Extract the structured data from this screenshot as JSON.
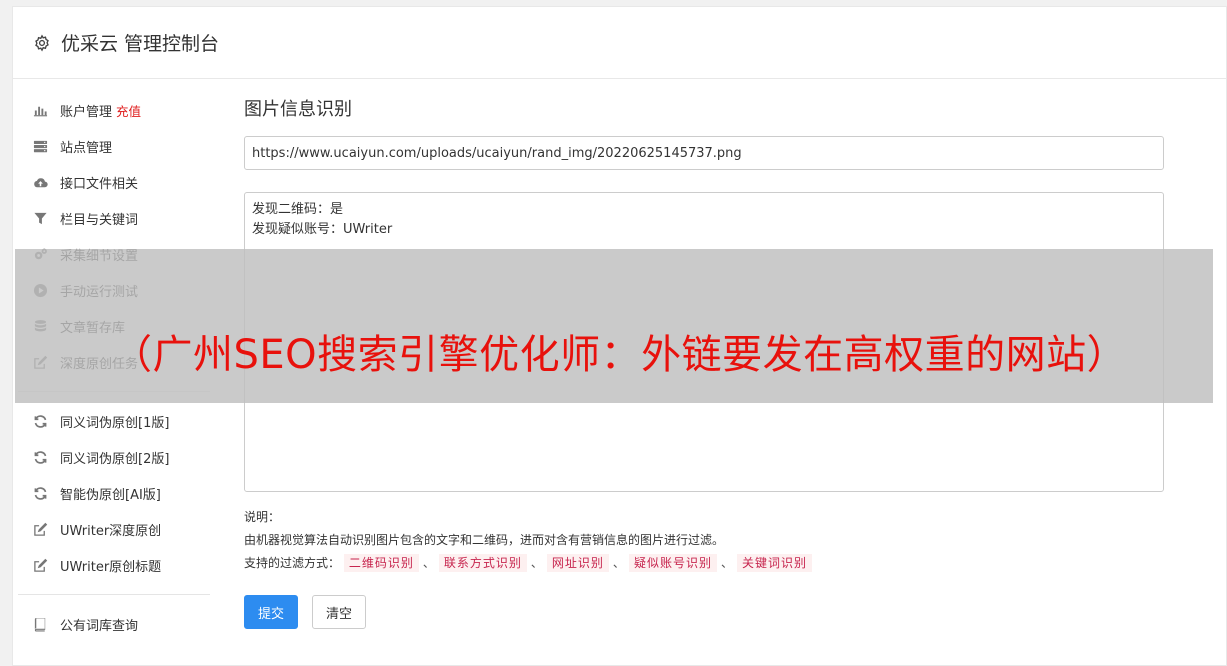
{
  "header": {
    "title": "优采云 管理控制台"
  },
  "sidebar": {
    "groups": [
      [
        {
          "label": "账户管理",
          "badge": "充值",
          "icon": "bar-chart-icon"
        },
        {
          "label": "站点管理",
          "icon": "server-icon"
        },
        {
          "label": "接口文件相关",
          "icon": "cloud-upload-icon"
        },
        {
          "label": "栏目与关键词",
          "icon": "filter-icon"
        },
        {
          "label": "采集细节设置",
          "icon": "gears-icon"
        },
        {
          "label": "手动运行测试",
          "icon": "play-circle-icon"
        },
        {
          "label": "文章暂存库",
          "icon": "database-icon"
        },
        {
          "label": "深度原创任务",
          "icon": "edit-icon"
        }
      ],
      [
        {
          "label": "同义词伪原创[1版]",
          "icon": "refresh-icon"
        },
        {
          "label": "同义词伪原创[2版]",
          "icon": "refresh-icon"
        },
        {
          "label": "智能伪原创[AI版]",
          "icon": "refresh-icon"
        },
        {
          "label": "UWriter深度原创",
          "icon": "edit-icon"
        },
        {
          "label": "UWriter原创标题",
          "icon": "edit-icon"
        }
      ],
      [
        {
          "label": "公有词库查询",
          "icon": "book-icon"
        }
      ]
    ]
  },
  "main": {
    "title": "图片信息识别",
    "url_value": "https://www.ucaiyun.com/uploads/ucaiyun/rand_img/20220625145737.png",
    "result_lines": [
      "发现二维码：是",
      "发现疑似账号：UWriter"
    ],
    "help_title": "说明：",
    "help_desc": "由机器视觉算法自动识别图片包含的文字和二维码，进而对含有营销信息的图片进行过滤。",
    "filter_label": "支持的过滤方式：",
    "filter_tags": [
      "二维码识别",
      "联系方式识别",
      "网址识别",
      "疑似账号识别",
      "关键词识别"
    ],
    "filter_sep": "、",
    "submit_label": "提交",
    "clear_label": "清空"
  },
  "overlay": {
    "text": "（广州SEO搜索引擎优化师：外链要发在高权重的网站）"
  }
}
